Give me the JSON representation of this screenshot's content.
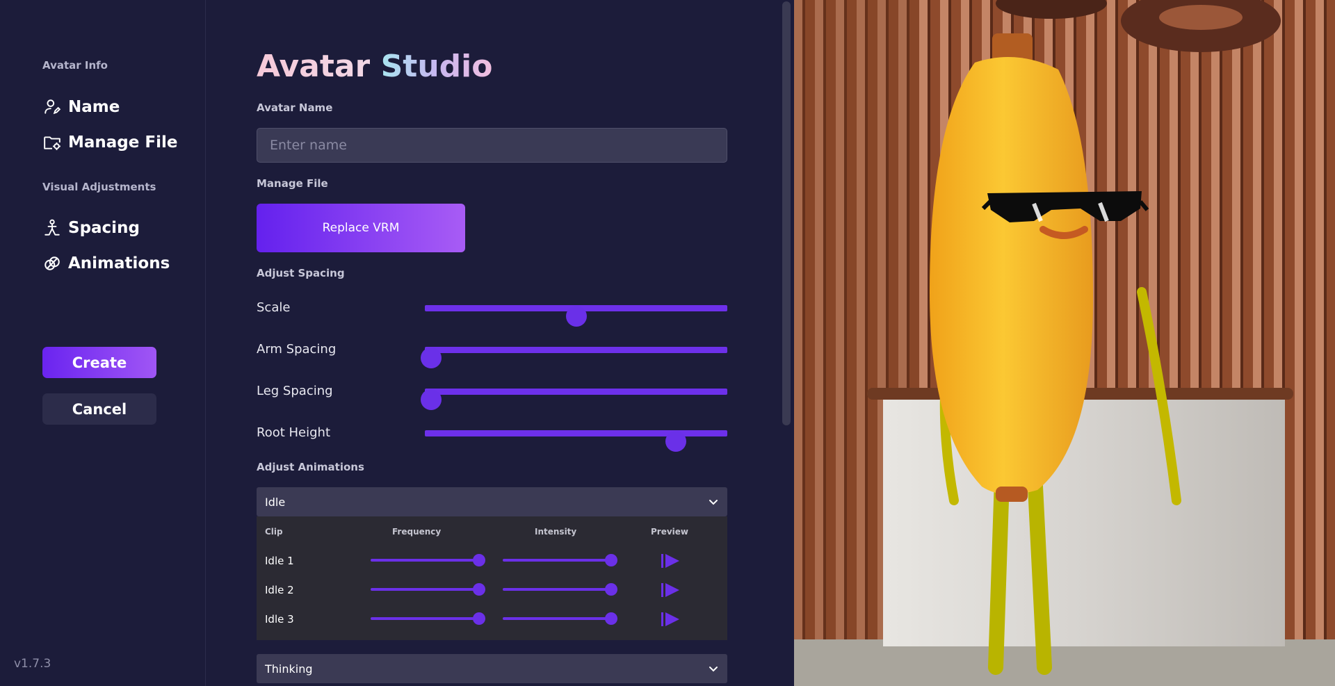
{
  "sidebar": {
    "section_avatar_info": "Avatar Info",
    "item_name": "Name",
    "item_manage_file": "Manage File",
    "section_visual": "Visual Adjustments",
    "item_spacing": "Spacing",
    "item_animations": "Animations",
    "create_label": "Create",
    "cancel_label": "Cancel",
    "version": "v1.7.3"
  },
  "main": {
    "title_part1": "Avatar",
    "title_part2": "Studio",
    "avatar_name_label": "Avatar Name",
    "name_placeholder": "Enter name",
    "name_value": "",
    "manage_file_label": "Manage File",
    "replace_label": "Replace VRM",
    "adjust_spacing_label": "Adjust Spacing",
    "sliders": [
      {
        "label": "Scale",
        "value": 0.5
      },
      {
        "label": "Arm Spacing",
        "value": 0.02
      },
      {
        "label": "Leg Spacing",
        "value": 0.02
      },
      {
        "label": "Root Height",
        "value": 0.83
      }
    ],
    "adjust_animations_label": "Adjust Animations",
    "accordion_idle": "Idle",
    "accordion_thinking": "Thinking",
    "clip_headers": {
      "clip": "Clip",
      "frequency": "Frequency",
      "intensity": "Intensity",
      "preview": "Preview"
    },
    "clips": [
      {
        "name": "Idle 1",
        "frequency": 1.0,
        "intensity": 1.0
      },
      {
        "name": "Idle 2",
        "frequency": 1.0,
        "intensity": 1.0
      },
      {
        "name": "Idle 3",
        "frequency": 1.0,
        "intensity": 1.0
      }
    ]
  },
  "colors": {
    "background": "#1c1c3a",
    "accent": "#6a30e8",
    "input_bg": "#3a3a55"
  }
}
